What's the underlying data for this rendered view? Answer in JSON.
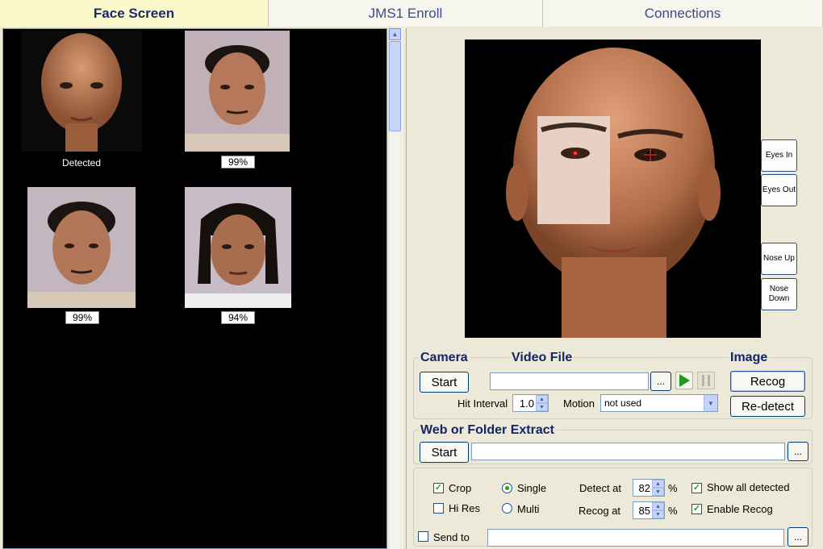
{
  "tabs": [
    "Face Screen",
    "JMS1 Enroll",
    "Connections"
  ],
  "results": [
    {
      "caption": "Detected"
    },
    {
      "caption": "99%"
    },
    {
      "caption": "99%"
    },
    {
      "caption": "94%"
    }
  ],
  "side_buttons": {
    "eyes_in": "Eyes In",
    "eyes_out": "Eyes Out",
    "nose_up": "Nose Up",
    "nose_down": "Nose Down"
  },
  "camera": {
    "label": "Camera",
    "start": "Start"
  },
  "video": {
    "label": "Video File",
    "path": "",
    "browse": "..."
  },
  "image": {
    "label": "Image",
    "recog": "Recog",
    "redetect": "Re-detect"
  },
  "hit_interval": {
    "label": "Hit Interval",
    "value": "1.0"
  },
  "motion": {
    "label": "Motion",
    "value": "not used"
  },
  "web": {
    "label": "Web or Folder Extract",
    "start": "Start",
    "path": "",
    "browse": "..."
  },
  "options": {
    "crop": "Crop",
    "hires": "Hi Res",
    "single": "Single",
    "multi": "Multi",
    "detect_label": "Detect at",
    "detect_value": "82",
    "recog_label": "Recog at",
    "recog_value": "85",
    "percent": "%",
    "show_all": "Show all detected",
    "enable_recog": "Enable Recog"
  },
  "send": {
    "label": "Send to",
    "path": "",
    "browse": "..."
  },
  "colors": {
    "accent": "#1d2a6e",
    "tab_active": "#fbf9cc",
    "check": "#21a121"
  }
}
